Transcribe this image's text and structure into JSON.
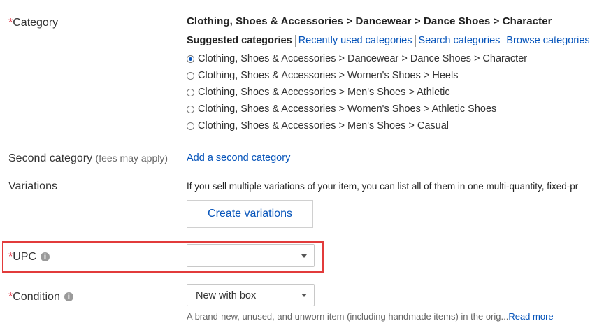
{
  "category": {
    "required_mark": "*",
    "label": "Category",
    "selected_path": "Clothing, Shoes & Accessories > Dancewear > Dance Shoes > Character",
    "tabs": [
      {
        "label": "Suggested categories"
      },
      {
        "label": "Recently used categories"
      },
      {
        "label": "Search categories"
      },
      {
        "label": "Browse categories"
      }
    ],
    "options": [
      {
        "label": "Clothing, Shoes & Accessories > Dancewear > Dance Shoes > Character",
        "checked": true
      },
      {
        "label": "Clothing, Shoes & Accessories > Women's Shoes > Heels",
        "checked": false
      },
      {
        "label": "Clothing, Shoes & Accessories > Men's Shoes > Athletic",
        "checked": false
      },
      {
        "label": "Clothing, Shoes & Accessories > Women's Shoes > Athletic Shoes",
        "checked": false
      },
      {
        "label": "Clothing, Shoes & Accessories > Men's Shoes > Casual",
        "checked": false
      }
    ]
  },
  "second_category": {
    "label": "Second category",
    "hint": "(fees may apply)",
    "link": "Add a second category"
  },
  "variations": {
    "label": "Variations",
    "description": "If you sell multiple variations of your item, you can list all of them in one multi-quantity, fixed-pr",
    "button": "Create variations"
  },
  "upc": {
    "required_mark": "*",
    "label": "UPC",
    "info_icon": "i",
    "value": ""
  },
  "condition": {
    "required_mark": "*",
    "label": "Condition",
    "info_icon": "i",
    "value": "New with box",
    "description": "A brand-new, unused, and unworn item (including handmade items) in the orig...",
    "read_more": "Read more"
  },
  "colors": {
    "required": "#dd1e31",
    "link": "#0654ba",
    "highlight": "#e23b3b"
  }
}
